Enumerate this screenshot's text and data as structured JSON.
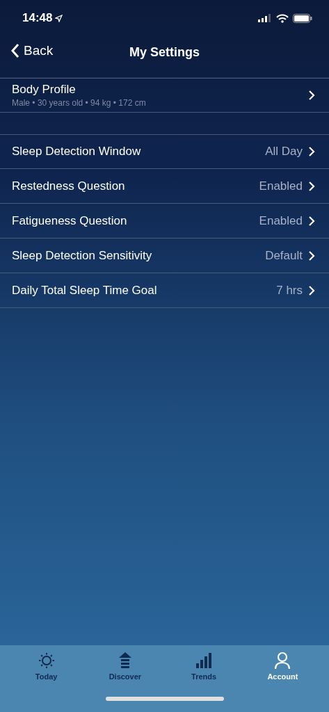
{
  "status_bar": {
    "time": "14:48"
  },
  "nav": {
    "back": "Back",
    "title": "My Settings"
  },
  "profile": {
    "title": "Body Profile",
    "subtitle": "Male • 30 years old • 94 kg • 172 cm"
  },
  "settings": [
    {
      "label": "Sleep Detection Window",
      "value": "All Day"
    },
    {
      "label": "Restedness Question",
      "value": "Enabled"
    },
    {
      "label": "Fatigueness Question",
      "value": "Enabled"
    },
    {
      "label": "Sleep Detection Sensitivity",
      "value": "Default"
    },
    {
      "label": "Daily Total Sleep Time Goal",
      "value": "7 hrs"
    }
  ],
  "tabs": [
    {
      "label": "Today",
      "kind": "sun",
      "selected": false
    },
    {
      "label": "Discover",
      "kind": "arrow",
      "selected": false
    },
    {
      "label": "Trends",
      "kind": "bars",
      "selected": false
    },
    {
      "label": "Account",
      "kind": "person",
      "selected": true
    }
  ]
}
